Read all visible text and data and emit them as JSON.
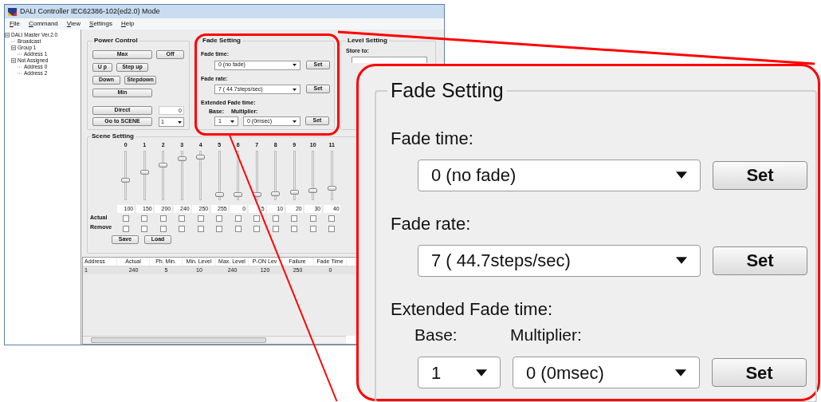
{
  "window": {
    "title": "DALI Controller IEC62386-102(ed2.0) Mode",
    "menu": [
      "File",
      "Command",
      "View",
      "Settings",
      "Help"
    ]
  },
  "tree": [
    {
      "label": "DALI Master Ver.2.0",
      "children": [
        {
          "label": "Broadcast"
        },
        {
          "label": "Group 1",
          "children": [
            {
              "label": "Address 1"
            }
          ]
        },
        {
          "label": "Not Assigned",
          "children": [
            {
              "label": "Address 0"
            },
            {
              "label": "Address 2"
            }
          ]
        }
      ]
    }
  ],
  "power_control": {
    "title": "Power Control",
    "buttons": [
      {
        "label": "Max"
      },
      {
        "label": "Off"
      },
      {
        "label": "U p"
      },
      {
        "label": "Step up"
      },
      {
        "label": "Down"
      },
      {
        "label": "Stepdown"
      },
      {
        "label": "Min"
      }
    ],
    "direct": {
      "label": "Direct",
      "value": "0"
    },
    "scene": {
      "label": "Go to SCENE",
      "value": "1"
    }
  },
  "fade_setting": {
    "title": "Fade Setting",
    "fade_time": {
      "label": "Fade time:",
      "value": "0 (no fade)",
      "button": "Set"
    },
    "fade_rate": {
      "label": "Fade rate:",
      "value": "7 ( 44.7steps/sec)",
      "button": "Set"
    },
    "extended": {
      "label": "Extended Fade time:",
      "base_label": "Base:",
      "multiplier_label": "Multiplier:",
      "base": "1",
      "multiplier": "0 (0msec)",
      "button": "Set"
    }
  },
  "level_setting": {
    "title": "Level Setting",
    "store_to_label": "Store to:"
  },
  "scene_setting": {
    "title": "Scene Setting",
    "actual_label": "Actual",
    "remove_label": "Remove",
    "scenes": [
      {
        "label": "0",
        "value": "100",
        "level": 0.4,
        "actual": false,
        "remove": false
      },
      {
        "label": "1",
        "value": "150",
        "level": 0.58,
        "actual": false,
        "remove": false
      },
      {
        "label": "2",
        "value": "200",
        "level": 0.74,
        "actual": false,
        "remove": false
      },
      {
        "label": "3",
        "value": "240",
        "level": 0.89,
        "actual": false,
        "remove": false
      },
      {
        "label": "4",
        "value": "250",
        "level": 0.92,
        "actual": false,
        "remove": false
      },
      {
        "label": "5",
        "value": "255",
        "level": 0.07,
        "actual": false,
        "remove": false
      },
      {
        "label": "6",
        "value": "0",
        "level": 0.07,
        "actual": false,
        "remove": false
      },
      {
        "label": "7",
        "value": "5",
        "level": 0.08,
        "actual": false,
        "remove": false
      },
      {
        "label": "8",
        "value": "10",
        "level": 0.1,
        "actual": false,
        "remove": false
      },
      {
        "label": "9",
        "value": "20",
        "level": 0.13,
        "actual": false,
        "remove": false
      },
      {
        "label": "10",
        "value": "30",
        "level": 0.17,
        "actual": false,
        "remove": false
      },
      {
        "label": "11",
        "value": "40",
        "level": 0.21,
        "actual": false,
        "remove": false
      }
    ],
    "buttons": [
      "Save",
      "Load"
    ]
  },
  "table": {
    "columns": [
      "Address",
      "Actual",
      "Ph. Min.",
      "Min. Level",
      "Max. Level",
      "P-ON Lev",
      "Failure",
      "Fade Time"
    ],
    "rows": [
      [
        "1",
        "240",
        "5",
        "10",
        "240",
        "120",
        "250",
        "0"
      ]
    ]
  },
  "callout": {
    "title": "Fade Setting",
    "fade_time": {
      "label": "Fade time:",
      "value": "0 (no fade)",
      "button": "Set"
    },
    "fade_rate": {
      "label": "Fade rate:",
      "value": "7 ( 44.7steps/sec)",
      "button": "Set"
    },
    "extended": {
      "label": "Extended Fade time:",
      "base_label": "Base:",
      "multiplier_label": "Multiplier:",
      "base": "1",
      "multiplier": "0 (0msec)",
      "button": "Set"
    }
  }
}
